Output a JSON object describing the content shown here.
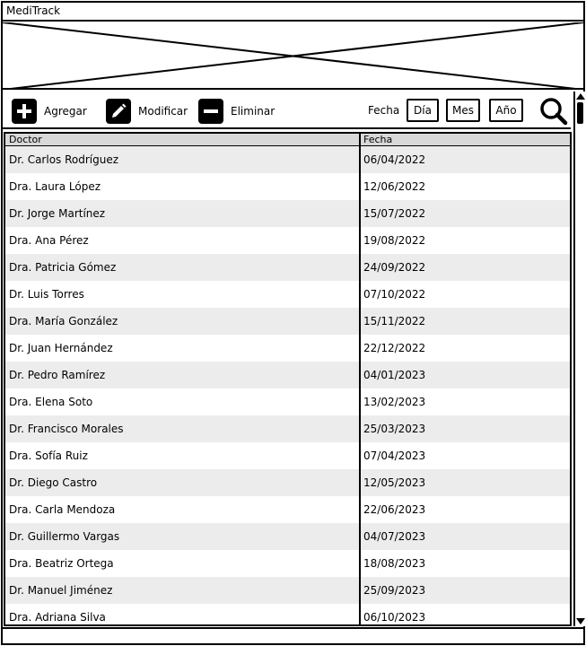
{
  "app": {
    "title": "MediTrack"
  },
  "toolbar": {
    "add_label": "Agregar",
    "edit_label": "Modificar",
    "delete_label": "Eliminar",
    "date_label": "Fecha",
    "day_label": "Día",
    "month_label": "Mes",
    "year_label": "Año",
    "icons": {
      "add": "plus-icon",
      "edit": "pencil-icon",
      "delete": "minus-icon",
      "search": "search-icon"
    }
  },
  "table": {
    "columns": [
      "Doctor",
      "Fecha"
    ],
    "rows": [
      [
        "Dr. Carlos Rodríguez",
        "06/04/2022"
      ],
      [
        "Dra. Laura López",
        "12/06/2022"
      ],
      [
        "Dr. Jorge Martínez",
        "15/07/2022"
      ],
      [
        "Dra. Ana Pérez",
        "19/08/2022"
      ],
      [
        "Dra. Patricia Gómez",
        "24/09/2022"
      ],
      [
        "Dr. Luis Torres",
        "07/10/2022"
      ],
      [
        "Dra. María González",
        "15/11/2022"
      ],
      [
        "Dr. Juan Hernández",
        "22/12/2022"
      ],
      [
        "Dr. Pedro Ramírez",
        "04/01/2023"
      ],
      [
        "Dra. Elena Soto",
        "13/02/2023"
      ],
      [
        "Dr. Francisco Morales",
        "25/03/2023"
      ],
      [
        "Dra. Sofía Ruiz",
        "07/04/2023"
      ],
      [
        "Dr. Diego Castro",
        "12/05/2023"
      ],
      [
        "Dra. Carla Mendoza",
        "22/06/2023"
      ],
      [
        "Dr. Guillermo Vargas",
        "04/07/2023"
      ],
      [
        "Dra. Beatriz Ortega",
        "18/08/2023"
      ],
      [
        "Dr. Manuel Jiménez",
        "25/09/2023"
      ],
      [
        "Dra. Adriana Silva",
        "06/10/2023"
      ]
    ]
  },
  "colors": {
    "header_bg": "#d9d9d9",
    "row_alt": "#ececec",
    "ink": "#000000"
  }
}
